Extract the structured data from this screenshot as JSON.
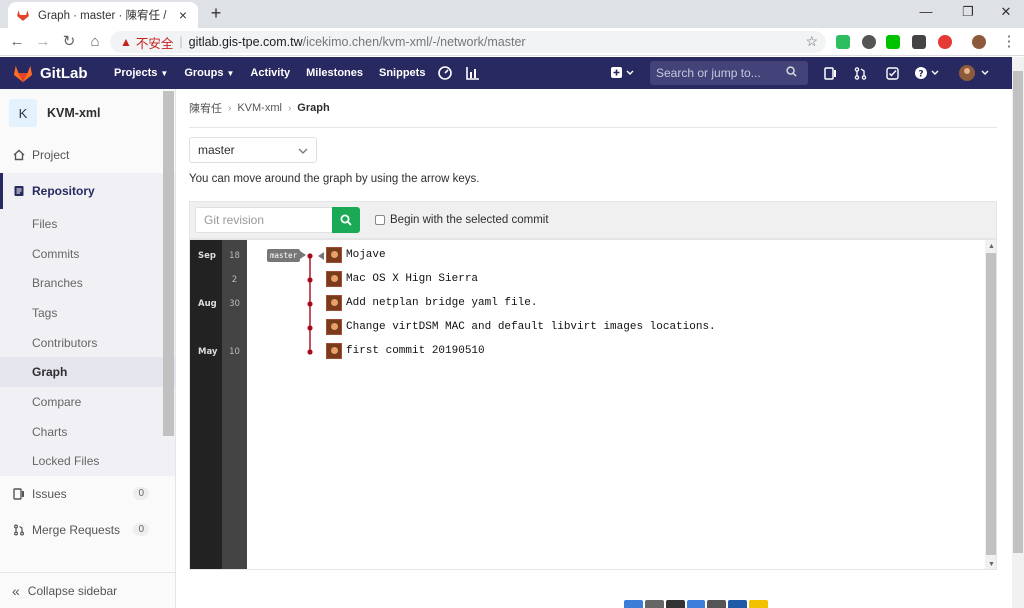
{
  "browser": {
    "tab_title": "Graph · master · 陳宥任 / KVM-xml · G",
    "tab_close": "×",
    "new_tab": "+",
    "insecure_label": "不安全",
    "url_host": "gitlab.gis-tpe.com.tw",
    "url_path": "/icekimo.chen/kvm-xml/-/network/master"
  },
  "header": {
    "logo_text": "GitLab",
    "nav": [
      "Projects",
      "Groups",
      "Activity",
      "Milestones",
      "Snippets"
    ],
    "search_placeholder": "Search or jump to..."
  },
  "sidebar": {
    "project_initial": "K",
    "project_name": "KVM-xml",
    "project_label": "Project",
    "repository_label": "Repository",
    "repo_items": [
      "Files",
      "Commits",
      "Branches",
      "Tags",
      "Contributors",
      "Graph",
      "Compare",
      "Charts",
      "Locked Files"
    ],
    "issues_label": "Issues",
    "issues_count": "0",
    "mr_label": "Merge Requests",
    "mr_count": "0",
    "collapse_label": "Collapse sidebar"
  },
  "breadcrumb": {
    "owner": "陳宥任",
    "project": "KVM-xml",
    "current": "Graph"
  },
  "branch_select": {
    "value": "master"
  },
  "hint": "You can move around the graph by using the arrow keys.",
  "revision": {
    "placeholder": "Git revision",
    "checkbox_label": "Begin with the selected commit"
  },
  "graph": {
    "branch_tag": "master",
    "months": [
      "Sep",
      "Aug",
      "May"
    ],
    "days": [
      "18",
      "2",
      "30",
      "10"
    ],
    "commits": [
      "Mojave",
      "Mac OS X Hign Sierra",
      "Add netplan bridge yaml file.",
      "Change virtDSM MAC and default libvirt images locations.",
      "first commit 20190510"
    ]
  },
  "colors": {
    "header_bg": "#292961",
    "accent_green": "#1aaa55",
    "graph_line": "#a50b1b"
  }
}
